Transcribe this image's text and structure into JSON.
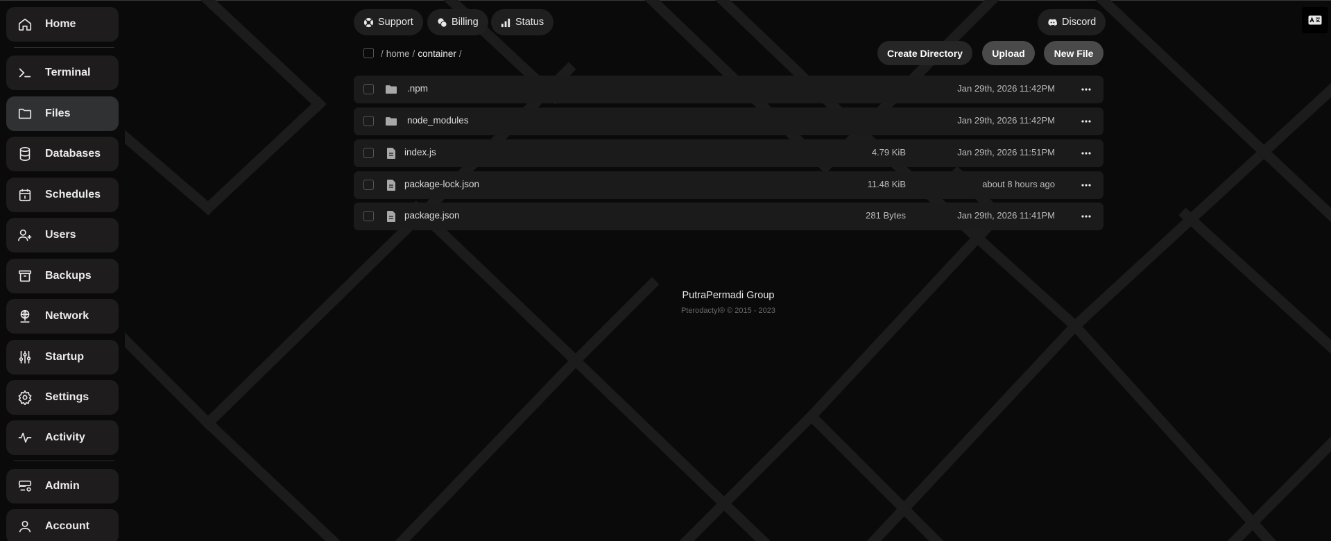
{
  "sidebar": {
    "items": [
      {
        "label": "Home",
        "icon": "home-icon"
      },
      {
        "label": "Terminal",
        "icon": "terminal-icon"
      },
      {
        "label": "Files",
        "icon": "folder-icon",
        "active": true
      },
      {
        "label": "Databases",
        "icon": "database-icon"
      },
      {
        "label": "Schedules",
        "icon": "calendar-icon"
      },
      {
        "label": "Users",
        "icon": "user-plus-icon"
      },
      {
        "label": "Backups",
        "icon": "archive-icon"
      },
      {
        "label": "Network",
        "icon": "globe-network-icon"
      },
      {
        "label": "Startup",
        "icon": "sliders-icon"
      },
      {
        "label": "Settings",
        "icon": "gear-icon"
      },
      {
        "label": "Activity",
        "icon": "activity-icon"
      },
      {
        "label": "Admin",
        "icon": "server-cog-icon"
      },
      {
        "label": "Account",
        "icon": "user-icon"
      }
    ]
  },
  "header": {
    "links": [
      {
        "label": "Support",
        "icon": "lifebuoy-icon"
      },
      {
        "label": "Billing",
        "icon": "coins-icon"
      },
      {
        "label": "Status",
        "icon": "signal-bars-icon"
      }
    ],
    "discord_label": "Discord"
  },
  "toolbar": {
    "create_directory_label": "Create Directory",
    "upload_label": "Upload",
    "new_file_label": "New File"
  },
  "breadcrumb": {
    "segments": [
      "home",
      "container"
    ],
    "separator": "/"
  },
  "files": [
    {
      "name": ".npm",
      "type": "folder",
      "size": "",
      "modified": "Jan 29th, 2026 11:42PM"
    },
    {
      "name": "node_modules",
      "type": "folder",
      "size": "",
      "modified": "Jan 29th, 2026 11:42PM"
    },
    {
      "name": "index.js",
      "type": "file",
      "size": "4.79 KiB",
      "modified": "Jan 29th, 2026 11:51PM"
    },
    {
      "name": "package-lock.json",
      "type": "file",
      "size": "11.48 KiB",
      "modified": "about 8 hours ago"
    },
    {
      "name": "package.json",
      "type": "file",
      "size": "281 Bytes",
      "modified": "Jan 29th, 2026 11:41PM"
    }
  ],
  "footer": {
    "title": "PutraPermadi Group",
    "subtitle": "Pterodactyl® © 2015 - 2023"
  },
  "colors": {
    "background": "#0a0a0a",
    "sidebar_item": "#1e1c1c",
    "sidebar_active": "#2f3133",
    "row": "#1b1b1b",
    "button_gray": "#4a4a4a"
  }
}
